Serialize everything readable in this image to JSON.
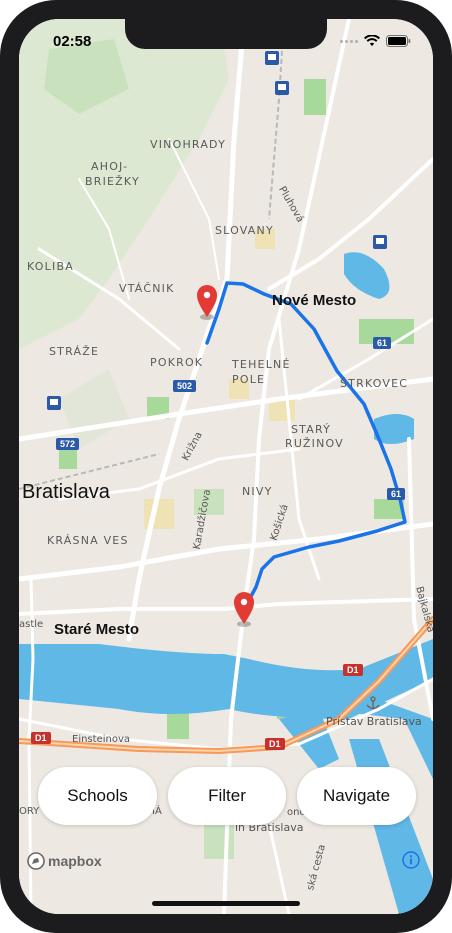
{
  "status_bar": {
    "time": "02:58"
  },
  "map": {
    "district_labels": [
      {
        "key": "vinohrady",
        "text": "VINOHRADY"
      },
      {
        "key": "ahoj",
        "text": "AHOJ-"
      },
      {
        "key": "briezky",
        "text": "BRIEŽKY"
      },
      {
        "key": "slovany",
        "text": "SLOVANY"
      },
      {
        "key": "koliba",
        "text": "KOLIBA"
      },
      {
        "key": "vtacnik",
        "text": "VTÁČNIK"
      },
      {
        "key": "straze",
        "text": "STRÁŽE"
      },
      {
        "key": "pokrok",
        "text": "POKROK"
      },
      {
        "key": "tehelne",
        "text": "TEHELNÉ"
      },
      {
        "key": "pole",
        "text": "POLE"
      },
      {
        "key": "strkovec",
        "text": "ŠTRKOVEC"
      },
      {
        "key": "stary",
        "text": "STARÝ"
      },
      {
        "key": "ruzinov",
        "text": "RUŽINOV"
      },
      {
        "key": "nivy",
        "text": "NIVY"
      },
      {
        "key": "krasna",
        "text": "KRÁSNA VES"
      }
    ],
    "city_labels": {
      "bratislava": "Bratislava",
      "nove_mesto": "Nové Mesto",
      "stare_mesto": "Staré Mesto"
    },
    "street_labels": {
      "pluhova": "Pluhová",
      "krizna": "Križna",
      "karadzicova": "Karadžičova",
      "kosicka": "Košická",
      "baj": "Bajkalská",
      "einsteinova": "Einsteinova",
      "castle": "astle",
      "pristav": "Prístav Bratislava",
      "in_bratislava": "in Bratislava",
      "ska_cesta": "ská cesta",
      "lono": "ono",
      "dry": "ORY",
      "ia": "IÁ"
    },
    "shields": {
      "r502": "502",
      "r572": "572",
      "r61a": "61",
      "r61b": "61",
      "d1a": "D1",
      "d1b": "D1",
      "d1c": "D1"
    },
    "attribution": "mapbox"
  },
  "actions": {
    "schools": "Schools",
    "filter": "Filter",
    "navigate": "Navigate"
  },
  "colors": {
    "route": "#1a73e8",
    "marker": "#e23b35",
    "motorway": "#f5995c",
    "water": "#60b8e6",
    "park": "#a7d99b",
    "land": "#ede9e2"
  }
}
